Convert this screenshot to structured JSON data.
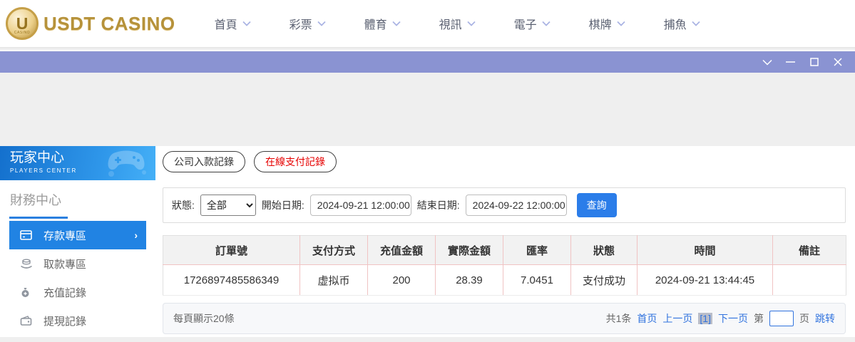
{
  "header": {
    "logo": {
      "brand": "USDT CASINO",
      "coin_letter": "U",
      "coin_caption": "CASINO"
    },
    "nav": [
      {
        "label": "首頁"
      },
      {
        "label": "彩票"
      },
      {
        "label": "體育"
      },
      {
        "label": "視訊"
      },
      {
        "label": "電子"
      },
      {
        "label": "棋牌"
      },
      {
        "label": "捕魚"
      }
    ]
  },
  "titlebar": {
    "controls": [
      "chevron-down",
      "minimize",
      "maximize",
      "close"
    ]
  },
  "sidebar": {
    "title": "玩家中心",
    "subtitle": "PLAYERS CENTER",
    "section": "財務中心",
    "items": [
      {
        "label": "存款專區",
        "active": true
      },
      {
        "label": "取款專區",
        "active": false
      },
      {
        "label": "充值記錄",
        "active": false
      },
      {
        "label": "提現記錄",
        "active": false
      }
    ]
  },
  "main": {
    "tabs": [
      {
        "label": "公司入款記錄",
        "active": false
      },
      {
        "label": "在線支付記錄",
        "active": true
      }
    ],
    "filters": {
      "status_label": "狀態:",
      "status_value": "全部",
      "start_label": "開始日期:",
      "start_value": "2024-09-21 12:00:00",
      "end_label": "結束日期:",
      "end_value": "2024-09-22 12:00:00",
      "search_label": "查詢"
    },
    "table": {
      "headers": [
        "訂單號",
        "支付方式",
        "充值金額",
        "實際金額",
        "匯率",
        "狀態",
        "時間",
        "備註"
      ],
      "rows": [
        [
          "1726897485586349",
          "虚拟币",
          "200",
          "28.39",
          "7.0451",
          "支付成功",
          "2024-09-21 13:44:45",
          ""
        ]
      ]
    },
    "pagination": {
      "page_size_text": "每頁顯示20條",
      "total_text": "共1条",
      "first": "首页",
      "prev": "上一页",
      "current": "[1]",
      "next": "下一页",
      "jump_prefix": "第",
      "jump_suffix": "页",
      "jump_label": "跳转",
      "jump_value": ""
    }
  },
  "colors": {
    "brand_gold": "#b6923a",
    "titlebar_purple": "#8a93d2",
    "active_blue": "#2183e3",
    "button_blue": "#2b7de9",
    "link_blue": "#3173de",
    "tab_red": "#e60000",
    "table_separator_pink": "#f0c3c3",
    "page_background": "#efefef"
  }
}
